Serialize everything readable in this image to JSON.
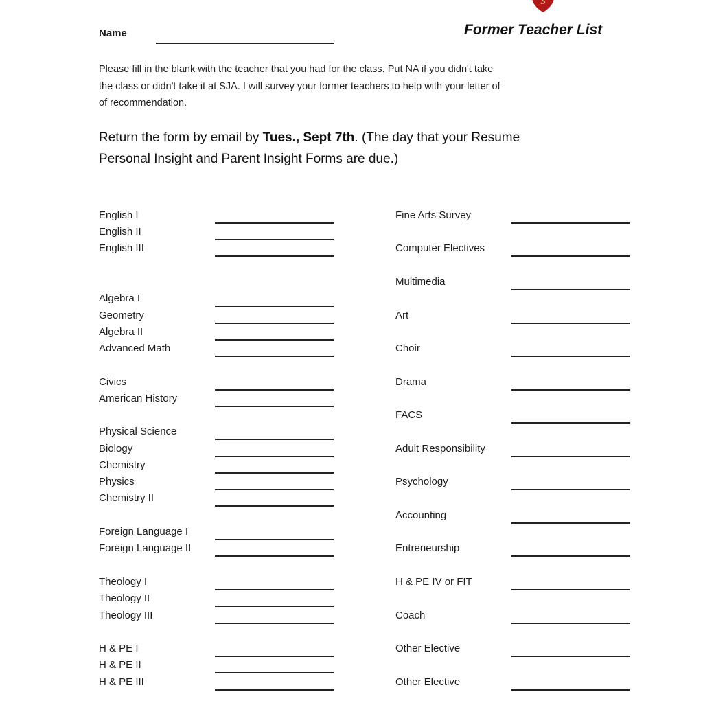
{
  "header": {
    "name_label": "Name",
    "name_value": "",
    "title": "Former Teacher List",
    "logo": "school-crest-icon",
    "logo_color": "#b21a1a"
  },
  "instructions": {
    "line1": "Please fill in the blank with the teacher that you had for the class.  Put NA if you didn't take",
    "line2": "the class or didn't take it at SJA.   I will survey your former teachers to help with your letter of",
    "line3": "of recommendation."
  },
  "deadline": {
    "prefix": "Return the form by email by ",
    "date": "Tues., Sept 7th",
    "suffix": ".  (The day that your Resume",
    "line2": "Personal Insight and Parent Insight Forms are due.)"
  },
  "left_column": [
    {
      "label": "English I",
      "value": ""
    },
    {
      "label": "English II",
      "value": ""
    },
    {
      "label": "English III",
      "value": ""
    },
    {
      "label": "Algebra I",
      "value": ""
    },
    {
      "label": "Geometry",
      "value": ""
    },
    {
      "label": "Algebra II",
      "value": ""
    },
    {
      "label": "Advanced Math",
      "value": ""
    },
    {
      "label": "Civics",
      "value": ""
    },
    {
      "label": "American History",
      "value": ""
    },
    {
      "label": "Physical Science",
      "value": ""
    },
    {
      "label": "Biology",
      "value": ""
    },
    {
      "label": "Chemistry",
      "value": ""
    },
    {
      "label": "Physics",
      "value": ""
    },
    {
      "label": "Chemistry II",
      "value": ""
    },
    {
      "label": "Foreign Language I",
      "value": ""
    },
    {
      "label": "Foreign Language II",
      "value": ""
    },
    {
      "label": "Theology I",
      "value": ""
    },
    {
      "label": "Theology II",
      "value": ""
    },
    {
      "label": "Theology III",
      "value": ""
    },
    {
      "label": "H & PE I",
      "value": ""
    },
    {
      "label": "H & PE II",
      "value": ""
    },
    {
      "label": "H & PE III",
      "value": ""
    }
  ],
  "right_column": [
    {
      "label": "Fine Arts Survey",
      "value": ""
    },
    {
      "label": "Computer Electives",
      "value": ""
    },
    {
      "label": "Multimedia",
      "value": ""
    },
    {
      "label": "Art",
      "value": ""
    },
    {
      "label": "Choir",
      "value": ""
    },
    {
      "label": "Drama",
      "value": ""
    },
    {
      "label": "FACS",
      "value": ""
    },
    {
      "label": "Adult Responsibility",
      "value": ""
    },
    {
      "label": "Psychology",
      "value": ""
    },
    {
      "label": "Accounting",
      "value": ""
    },
    {
      "label": "Entreneurship",
      "value": ""
    },
    {
      "label": "H & PE IV or FIT",
      "value": ""
    },
    {
      "label": "Coach",
      "value": ""
    },
    {
      "label": "Other Elective",
      "value": ""
    },
    {
      "label": "Other Elective",
      "value": ""
    }
  ]
}
